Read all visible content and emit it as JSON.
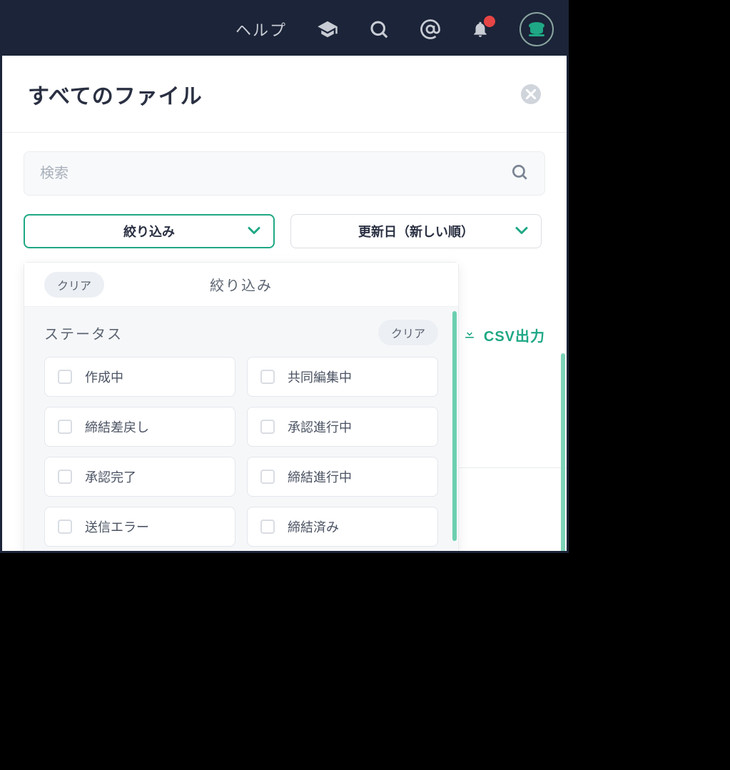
{
  "topbar": {
    "help_label": "ヘルプ"
  },
  "page": {
    "title": "すべてのファイル"
  },
  "search": {
    "placeholder": "検索"
  },
  "filters": {
    "filter_label": "絞り込み",
    "sort_label": "更新日（新しい順）"
  },
  "filter_panel": {
    "clear_all": "クリア",
    "title": "絞り込み",
    "status_section": "ステータス",
    "status_clear": "クリア",
    "status_options": [
      "作成中",
      "共同編集中",
      "締結差戻し",
      "承認進行中",
      "承認完了",
      "締結進行中",
      "送信エラー",
      "締結済み"
    ]
  },
  "actions": {
    "csv_export": "CSV出力"
  },
  "colors": {
    "accent": "#1fa885",
    "navbar": "#1b2438"
  }
}
